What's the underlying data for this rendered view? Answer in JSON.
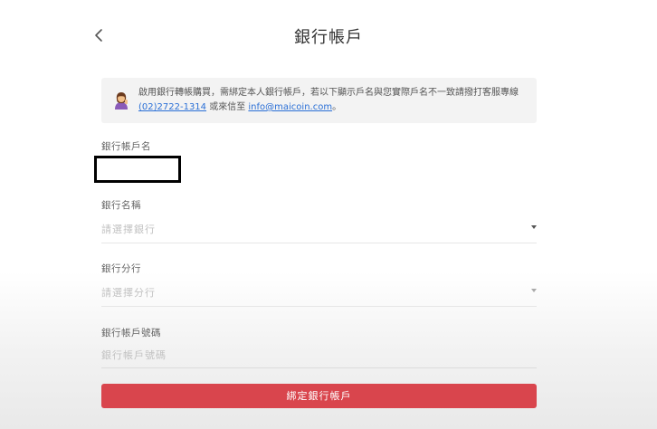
{
  "header": {
    "title": "銀行帳戶"
  },
  "notice": {
    "text_part1": "啟用銀行轉帳購買，需綁定本人銀行帳戶，若以下顯示戶名與您實際戶名不一致請撥打客服專線 ",
    "phone": "(02)2722-1314",
    "text_part2": " 或來信至 ",
    "email": "info@maicoin.com",
    "text_part3": "。"
  },
  "form": {
    "account_name_label": "銀行帳戶名",
    "bank_name_label": "銀行名稱",
    "bank_name_placeholder": "請選擇銀行",
    "branch_label": "銀行分行",
    "branch_placeholder": "請選擇分行",
    "account_number_label": "銀行帳戶號碼",
    "account_number_placeholder": "銀行帳戶號碼",
    "submit_label": "綁定銀行帳戶"
  },
  "colors": {
    "accent": "#d9454d",
    "link": "#2a6fd6",
    "notice_bg": "#f3f3f3"
  },
  "icons": {
    "back": "chevron-left-icon",
    "avatar": "support-agent-icon",
    "dropdown": "caret-down-icon"
  }
}
